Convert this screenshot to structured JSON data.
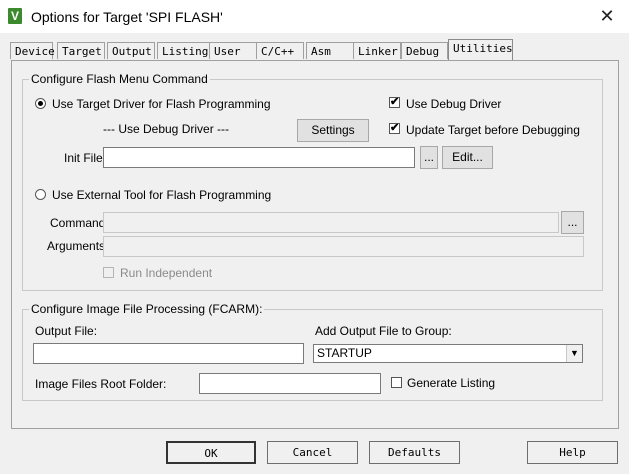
{
  "window": {
    "title": "Options for Target 'SPI FLASH'",
    "app_icon": "V",
    "close_glyph": "✕"
  },
  "tabs": [
    {
      "label": "Device",
      "active": false
    },
    {
      "label": "Target",
      "active": false
    },
    {
      "label": "Output",
      "active": false
    },
    {
      "label": "Listing",
      "active": false
    },
    {
      "label": "User",
      "active": false
    },
    {
      "label": "C/C++",
      "active": false
    },
    {
      "label": "Asm",
      "active": false
    },
    {
      "label": "Linker",
      "active": false
    },
    {
      "label": "Debug",
      "active": false
    },
    {
      "label": "Utilities",
      "active": true
    }
  ],
  "flash": {
    "group_title": "Configure Flash Menu Command",
    "use_target_driver_label": "Use Target Driver for Flash Programming",
    "use_target_driver_selected": true,
    "driver_select_value": "--- Use Debug Driver ---",
    "settings_label": "Settings",
    "use_debug_driver_label": "Use Debug Driver",
    "use_debug_driver_checked": true,
    "update_target_label": "Update Target before Debugging",
    "update_target_checked": true,
    "init_file_label": "Init File:",
    "init_file_value": "",
    "browse_label": "...",
    "edit_label": "Edit...",
    "use_external_label": "Use External Tool for Flash Programming",
    "use_external_selected": false,
    "command_label": "Command:",
    "command_value": "",
    "arguments_label": "Arguments:",
    "arguments_value": "",
    "run_independent_label": "Run Independent",
    "run_independent_checked": false
  },
  "image": {
    "group_title": "Configure Image File Processing (FCARM):",
    "output_file_label": "Output File:",
    "output_file_value": "",
    "add_output_label": "Add Output File  to Group:",
    "group_select_value": "STARTUP",
    "root_folder_label": "Image Files Root Folder:",
    "root_folder_value": "",
    "generate_listing_label": "Generate Listing",
    "generate_listing_checked": false
  },
  "footer": {
    "ok_label": "OK",
    "cancel_label": "Cancel",
    "defaults_label": "Defaults",
    "help_label": "Help"
  },
  "glyphs": {
    "check": "✔",
    "dropdown": "▼"
  }
}
